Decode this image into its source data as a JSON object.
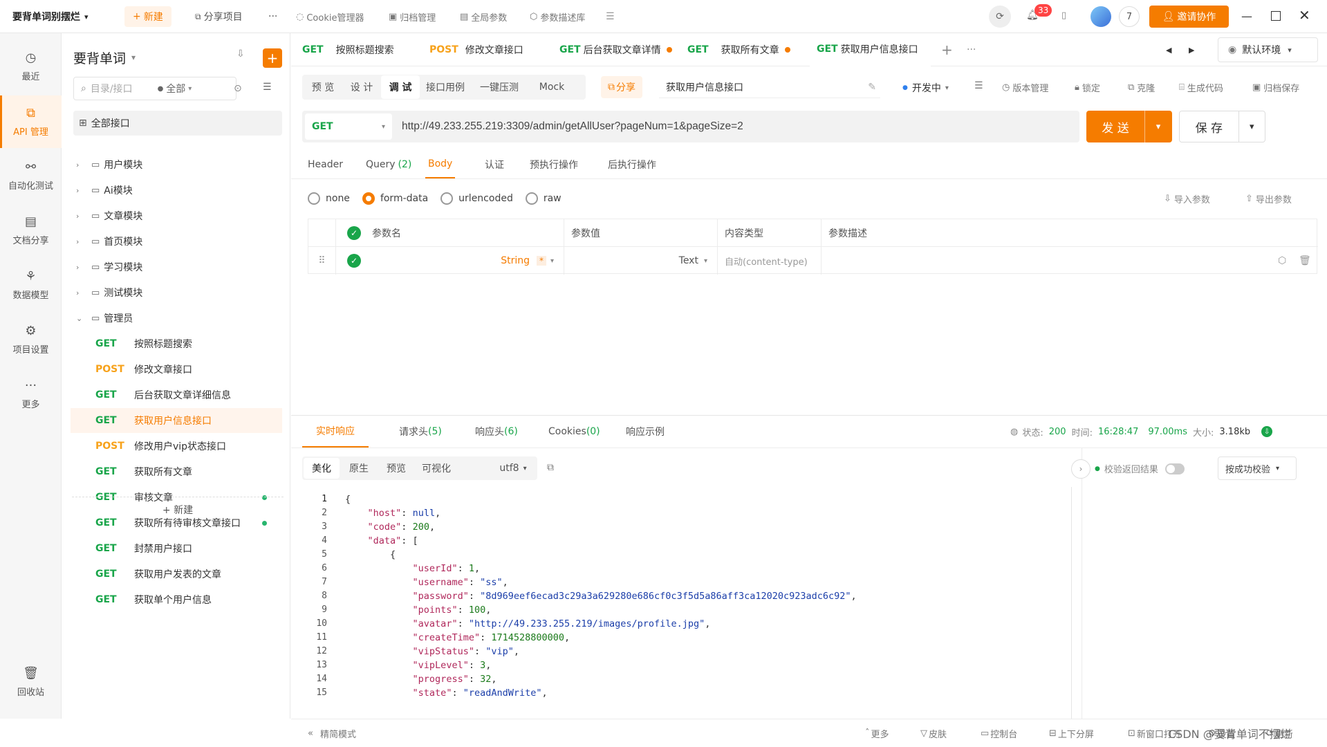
{
  "topbar": {
    "project_name": "要背单词别摆烂",
    "new_button": "新建",
    "share_project": "分享项目",
    "more": "···",
    "cookie_manager": "Cookie管理器",
    "archive_manager": "归档管理",
    "global_params": "全局参数",
    "param_desc_lib": "参数描述库",
    "notif_count": "33",
    "user_count": "7",
    "invite_button": "邀请协作"
  },
  "leftnav": {
    "items": [
      {
        "label": "最近",
        "icon": "clock-icon"
      },
      {
        "label": "API 管理",
        "icon": "api-icon"
      },
      {
        "label": "自动化测试",
        "icon": "flow-icon"
      },
      {
        "label": "文档分享",
        "icon": "doc-icon"
      },
      {
        "label": "数据模型",
        "icon": "model-icon"
      },
      {
        "label": "项目设置",
        "icon": "settings-icon"
      },
      {
        "label": "更多",
        "icon": "more-icon"
      },
      {
        "label": "回收站",
        "icon": "trash-icon"
      }
    ]
  },
  "tree": {
    "title": "要背单词",
    "search_placeholder": "目录/接口",
    "filter": "全部",
    "all_apis": "全部接口",
    "folders": [
      "用户模块",
      "Ai模块",
      "文章模块",
      "首页模块",
      "学习模块",
      "测试模块",
      "管理员"
    ],
    "apis": [
      {
        "method": "GET",
        "name": "按照标题搜索"
      },
      {
        "method": "POST",
        "name": "修改文章接口"
      },
      {
        "method": "GET",
        "name": "后台获取文章详细信息"
      },
      {
        "method": "GET",
        "name": "获取用户信息接口"
      },
      {
        "method": "POST",
        "name": "修改用户vip状态接口"
      },
      {
        "method": "GET",
        "name": "获取所有文章"
      },
      {
        "method": "GET",
        "name": "审核文章"
      },
      {
        "method": "GET",
        "name": "获取所有待审核文章接口"
      },
      {
        "method": "GET",
        "name": "封禁用户接口"
      },
      {
        "method": "GET",
        "name": "获取用户发表的文章"
      },
      {
        "method": "GET",
        "name": "获取单个用户信息"
      }
    ],
    "new_label": "+ 新建"
  },
  "tabs": [
    {
      "method": "GET",
      "name": "按照标题搜索"
    },
    {
      "method": "POST",
      "name": "修改文章接口"
    },
    {
      "method": "GET",
      "name": "后台获取文章详情"
    },
    {
      "method": "GET",
      "name": "获取所有文章"
    },
    {
      "method": "GET",
      "name": "获取用户信息接口"
    }
  ],
  "env": "默认环境",
  "subtabs": [
    "预 览",
    "设 计",
    "调 试",
    "接口用例",
    "一键压测",
    "Mock"
  ],
  "share": "分享",
  "api_title": "获取用户信息接口",
  "status": "开发中",
  "actions": [
    "版本管理",
    "锁定",
    "克隆",
    "生成代码",
    "归档保存"
  ],
  "request": {
    "method": "GET",
    "url": "http://49.233.255.219:3309/admin/getAllUser?pageNum=1&pageSize=2",
    "send": "发 送",
    "save": "保 存"
  },
  "reqtabs": [
    "Header",
    "Query",
    "(2)",
    "Body",
    "认证",
    "预执行操作",
    "后执行操作"
  ],
  "body_types": [
    "none",
    "form-data",
    "urlencoded",
    "raw"
  ],
  "import_params": "导入参数",
  "export_params": "导出参数",
  "param_table": {
    "headers": [
      "参数名",
      "参数值",
      "内容类型",
      "参数描述"
    ],
    "row": {
      "type": "String",
      "required": "*",
      "value_type": "Text",
      "content_type": "自动(content-type)"
    }
  },
  "resp_tabs": [
    "实时响应",
    "请求头",
    "(5)",
    "响应头",
    "(6)",
    "Cookies",
    "(0)",
    "响应示例"
  ],
  "resp_status": {
    "label_status": "状态:",
    "code": "200",
    "label_time": "时间:",
    "time": "16:28:47",
    "duration": "97.00ms",
    "label_size": "大小:",
    "size": "3.18kb"
  },
  "view_tabs": [
    "美化",
    "原生",
    "预览",
    "可视化"
  ],
  "encoding": "utf8",
  "verify_label": "校验返回结果",
  "verify_mode": "按成功校验",
  "code_lines": [
    {
      "n": "1",
      "t": "{"
    },
    {
      "n": "2",
      "t": "    \"host\": null,"
    },
    {
      "n": "3",
      "t": "    \"code\": 200,"
    },
    {
      "n": "4",
      "t": "    \"data\": ["
    },
    {
      "n": "5",
      "t": "        {"
    },
    {
      "n": "6",
      "t": "            \"userId\": 1,"
    },
    {
      "n": "7",
      "t": "            \"username\": \"ss\","
    },
    {
      "n": "8",
      "t": "            \"password\": \"8d969eef6ecad3c29a3a629280e686cf0c3f5d5a86aff3ca12020c923adc6c92\","
    },
    {
      "n": "9",
      "t": "            \"points\": 100,"
    },
    {
      "n": "10",
      "t": "            \"avatar\": \"http://49.233.255.219/images/profile.jpg\","
    },
    {
      "n": "11",
      "t": "            \"createTime\": 1714528800000,"
    },
    {
      "n": "12",
      "t": "            \"vipStatus\": \"vip\","
    },
    {
      "n": "13",
      "t": "            \"vipLevel\": 3,"
    },
    {
      "n": "14",
      "t": "            \"progress\": 32,"
    },
    {
      "n": "15",
      "t": "            \"state\": \"readAndWrite\","
    }
  ],
  "footer": {
    "compact": "精简模式",
    "items": [
      "更多",
      "皮肤",
      "控制台",
      "上下分屏",
      "新窗口打开",
      "设置",
      "更新"
    ],
    "watermark": "CSDN @要背单词不摆烂"
  }
}
